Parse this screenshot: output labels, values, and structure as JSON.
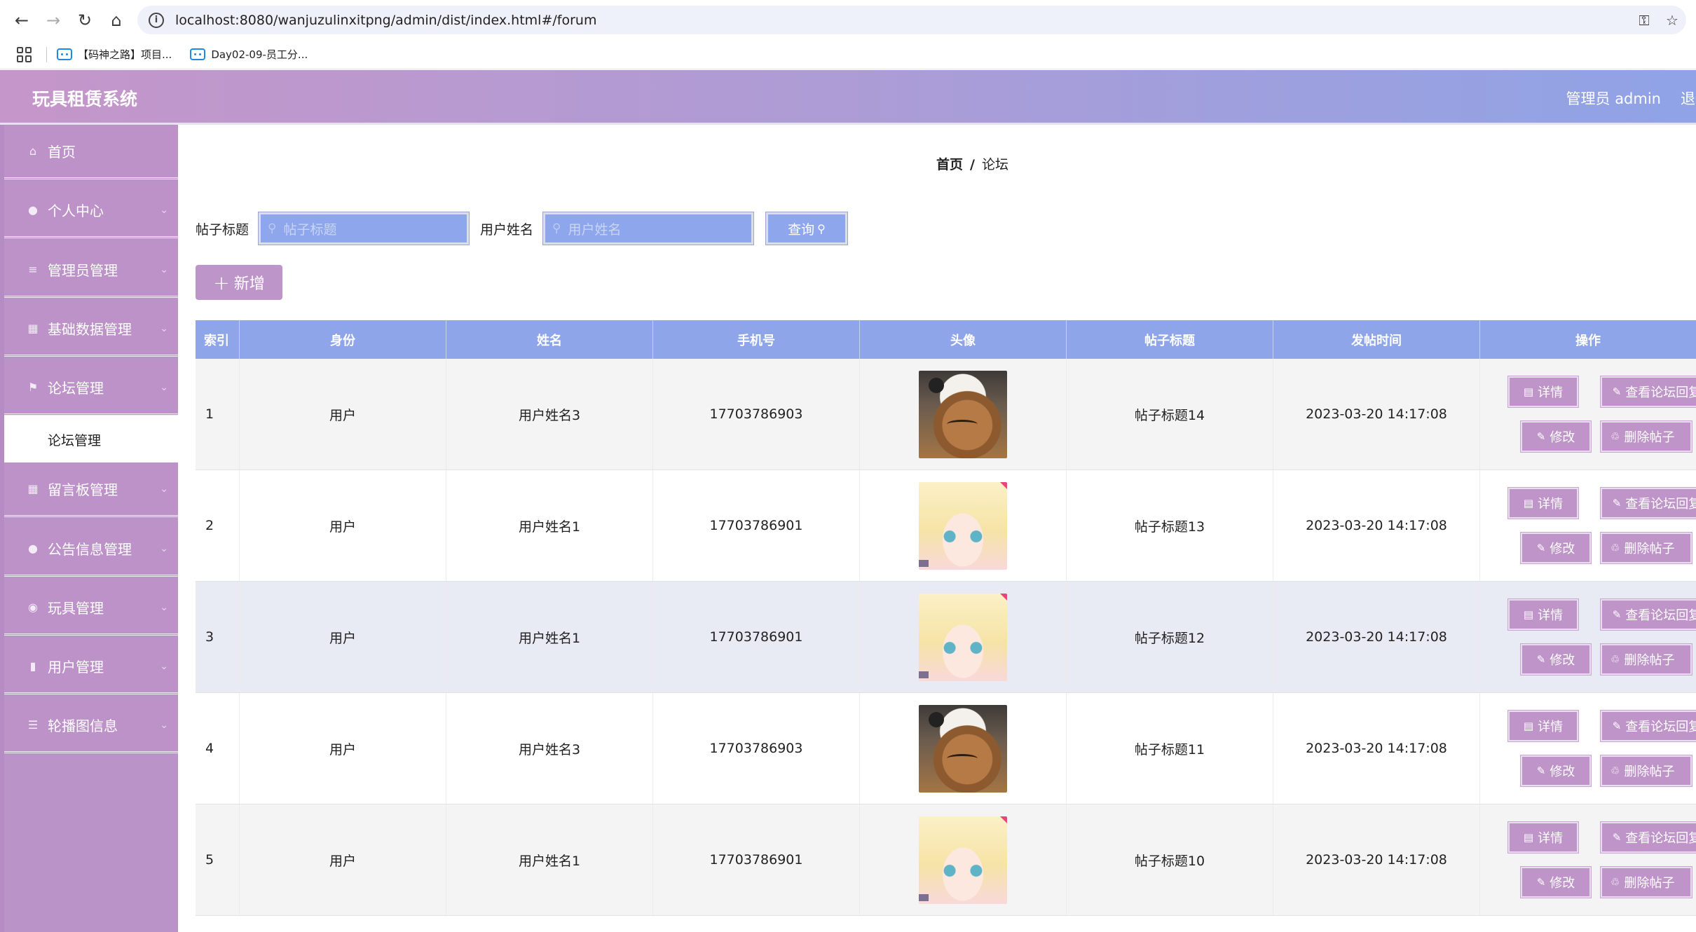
{
  "browser": {
    "url": "localhost:8080/wanjuzulinxitpng/admin/dist/index.html#/forum",
    "bookmarks": [
      "【码神之路】项目...",
      "Day02-09-员工分..."
    ]
  },
  "app": {
    "title": "玩具租赁系统",
    "user": "管理员 admin",
    "logout": "退出登录"
  },
  "sidebar": {
    "items": [
      {
        "label": "首页",
        "icon": "home-icon",
        "arrow": false
      },
      {
        "label": "个人中心",
        "icon": "user-icon",
        "arrow": true
      },
      {
        "label": "管理员管理",
        "icon": "sliders-icon",
        "arrow": true
      },
      {
        "label": "基础数据管理",
        "icon": "grid-icon",
        "arrow": true
      },
      {
        "label": "论坛管理",
        "icon": "flag-icon",
        "arrow": true
      },
      {
        "label": "留言板管理",
        "icon": "grid-icon",
        "arrow": true
      },
      {
        "label": "公告信息管理",
        "icon": "user-icon",
        "arrow": true
      },
      {
        "label": "玩具管理",
        "icon": "location-icon",
        "arrow": true
      },
      {
        "label": "用户管理",
        "icon": "chart-icon",
        "arrow": true
      },
      {
        "label": "轮播图信息",
        "icon": "menu-icon",
        "arrow": true
      }
    ],
    "submenu_active": "论坛管理"
  },
  "breadcrumb": {
    "home": "首页",
    "separator": "/",
    "current": "论坛"
  },
  "search": {
    "title_label": "帖子标题",
    "title_placeholder": "帖子标题",
    "user_label": "用户姓名",
    "user_placeholder": "用户姓名",
    "query_button": "查询"
  },
  "add_button": "新增",
  "table": {
    "headers": [
      "索引",
      "身份",
      "姓名",
      "手机号",
      "头像",
      "帖子标题",
      "发帖时间",
      "操作"
    ],
    "rows": [
      {
        "index": "1",
        "role": "用户",
        "name": "用户姓名3",
        "phone": "17703786903",
        "avatar": "cat",
        "title": "帖子标题14",
        "time": "2023-03-20 14:17:08"
      },
      {
        "index": "2",
        "role": "用户",
        "name": "用户姓名1",
        "phone": "17703786901",
        "avatar": "anime",
        "title": "帖子标题13",
        "time": "2023-03-20 14:17:08"
      },
      {
        "index": "3",
        "role": "用户",
        "name": "用户姓名1",
        "phone": "17703786901",
        "avatar": "anime",
        "title": "帖子标题12",
        "time": "2023-03-20 14:17:08"
      },
      {
        "index": "4",
        "role": "用户",
        "name": "用户姓名3",
        "phone": "17703786903",
        "avatar": "cat",
        "title": "帖子标题11",
        "time": "2023-03-20 14:17:08"
      },
      {
        "index": "5",
        "role": "用户",
        "name": "用户姓名1",
        "phone": "17703786901",
        "avatar": "anime",
        "title": "帖子标题10",
        "time": "2023-03-20 14:17:08"
      }
    ],
    "actions": {
      "detail": "详情",
      "view_replies": "查看论坛回复",
      "edit": "修改",
      "delete": "删除帖子"
    }
  },
  "colors": {
    "header_start": "#c596c9",
    "header_end": "#8fa3e6",
    "sidebar": "#ba93c9",
    "table_header": "#8ea5ea",
    "button": "#bf95c9"
  }
}
